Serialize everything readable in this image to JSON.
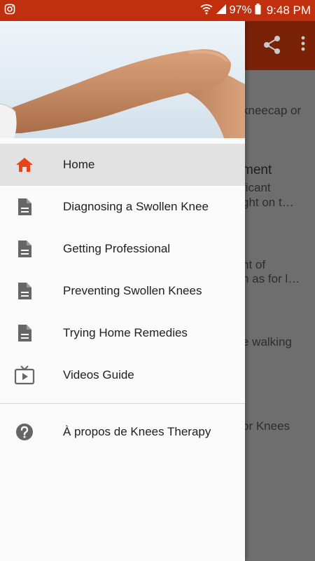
{
  "status_bar": {
    "left_icon": "instagram-icon",
    "battery_percent": "97%",
    "time": "9:48 PM"
  },
  "toolbar": {
    "icons": [
      "share-icon",
      "more-vert-icon"
    ]
  },
  "background_text": [
    "kneecap or",
    "ment",
    "ficant",
    "ght on t…",
    "nt of",
    "n as for l…",
    "e walking",
    "or Knees"
  ],
  "drawer": {
    "items": [
      {
        "label": "Home",
        "icon": "home-icon",
        "active": true
      },
      {
        "label": "Diagnosing a Swollen Knee",
        "icon": "document-icon"
      },
      {
        "label": "Getting Professional",
        "icon": "document-icon"
      },
      {
        "label": "Preventing Swollen Knees",
        "icon": "document-icon"
      },
      {
        "label": "Trying Home Remedies",
        "icon": "document-icon"
      },
      {
        "label": "Videos Guide",
        "icon": "tv-icon"
      }
    ],
    "footer_items": [
      {
        "label": "À propos de Knees Therapy",
        "icon": "help-icon"
      }
    ]
  },
  "colors": {
    "accent": "#c0300f",
    "active_icon": "#e8441a",
    "icon_gray": "#666666"
  }
}
